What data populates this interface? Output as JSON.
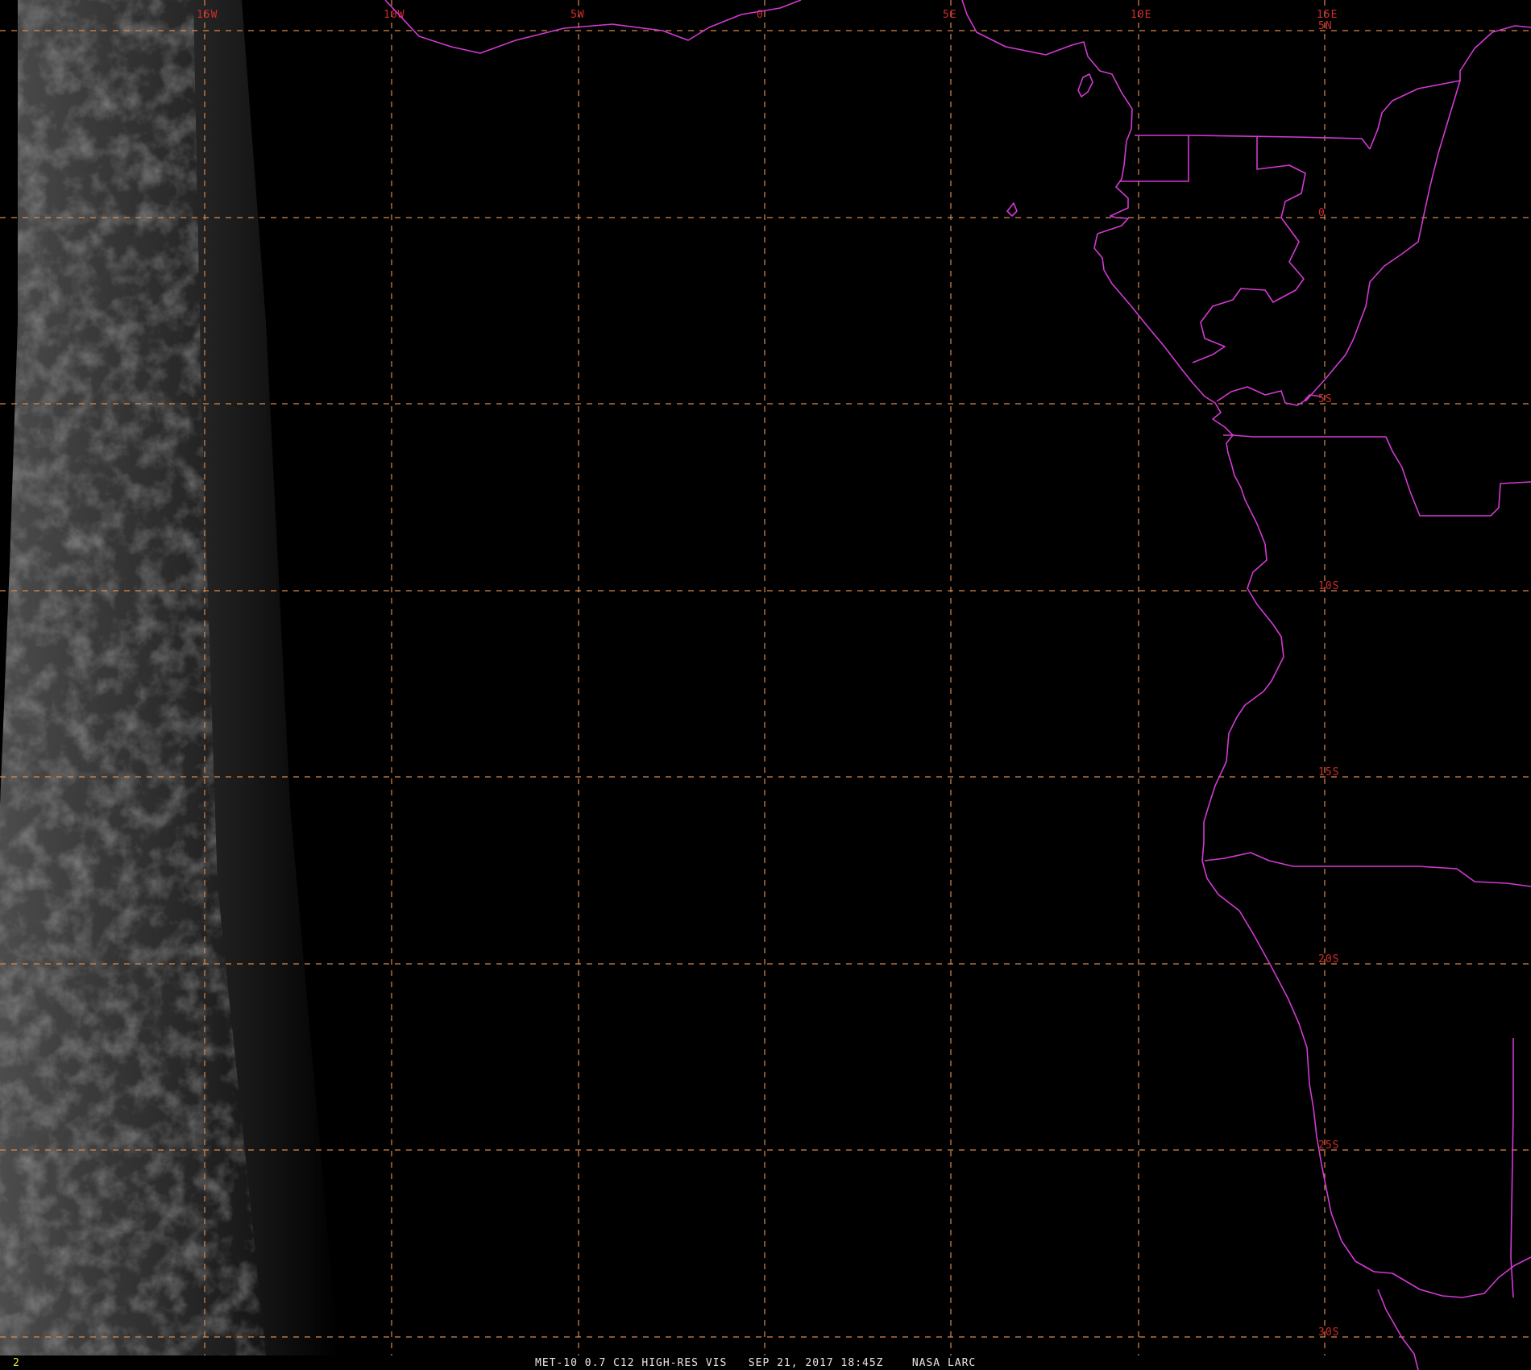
{
  "image": {
    "caption": "MET-10 0.7 C12 HIGH-RES VIS   SEP 21, 2017 18:45Z    NASA LARC",
    "frame_number": "2"
  },
  "colors": {
    "background": "#000000",
    "grid": "#d98a4a",
    "label": "#d22a2a",
    "border": "#d23ad2",
    "frame_number": "#f0e63c",
    "caption": "#e6e6e6"
  },
  "grid": {
    "longitude_labels": [
      "15W",
      "10W",
      "5W",
      "0",
      "5E",
      "10E",
      "15E"
    ],
    "latitude_labels": [
      "5N",
      "0",
      "5S",
      "10S",
      "15S",
      "20S",
      "25S",
      "30S"
    ]
  }
}
